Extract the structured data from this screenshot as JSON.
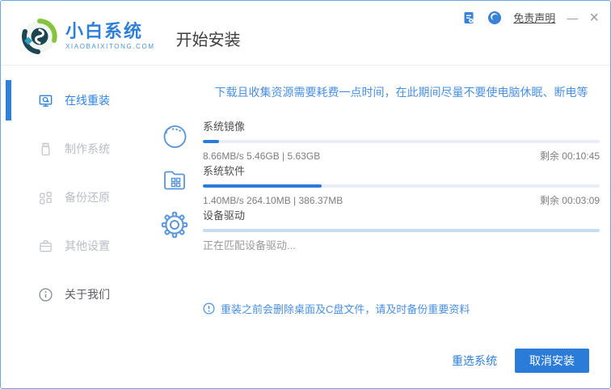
{
  "window": {
    "brand": {
      "name": "小白系统",
      "domain": "XIAOBAIXITONG.COM"
    },
    "page_title": "开始安装",
    "titlebar": {
      "disclaimer_label": "免责声明",
      "minimize_label": "—",
      "close_label": "×",
      "icons": [
        "feedback-doc-icon",
        "customer-service-icon"
      ]
    }
  },
  "sidebar": {
    "items": [
      {
        "label": "在线重装",
        "icon": "monitor-reinstall-icon",
        "active": true
      },
      {
        "label": "制作系统",
        "icon": "usb-drive-icon",
        "active": false
      },
      {
        "label": "备份还原",
        "icon": "grid-backup-icon",
        "active": false
      },
      {
        "label": "其他设置",
        "icon": "briefcase-icon",
        "active": false
      },
      {
        "label": "关于我们",
        "icon": "info-circle-icon",
        "active": false
      }
    ]
  },
  "main": {
    "notice": "下载且收集资源需要耗费一点时间，在此期间尽量不要使电脑休眠、断电等",
    "tasks": [
      {
        "name": "系统镜像",
        "icon": "mascot-face-icon",
        "progress_percent": 4,
        "stats": "8.66MB/s 5.46GB | 5.63GB",
        "remaining": "剩余 00:10:45"
      },
      {
        "name": "系统软件",
        "icon": "folder-apps-icon",
        "progress_percent": 30,
        "stats": "1.40MB/s 264.10MB | 386.37MB",
        "remaining": "剩余 00:03:09"
      },
      {
        "name": "设备驱动",
        "icon": "gear-icon",
        "progress_percent": 0,
        "status_text": "正在匹配设备驱动..."
      }
    ],
    "warning": "重装之前会删除桌面及C盘文件，请及时备份重要资料",
    "footer": {
      "reselect_label": "重选系统",
      "cancel_label": "取消安装"
    }
  },
  "colors": {
    "accent_blue": "#2e7fd8",
    "notice_blue": "#4a90e2",
    "progress_fill": "#2b7cd9",
    "progress_track": "#e9eef6",
    "driver_track": "#c6dcf4",
    "window_border": "#6ba5e7",
    "inactive_gray": "#b9bec6"
  }
}
